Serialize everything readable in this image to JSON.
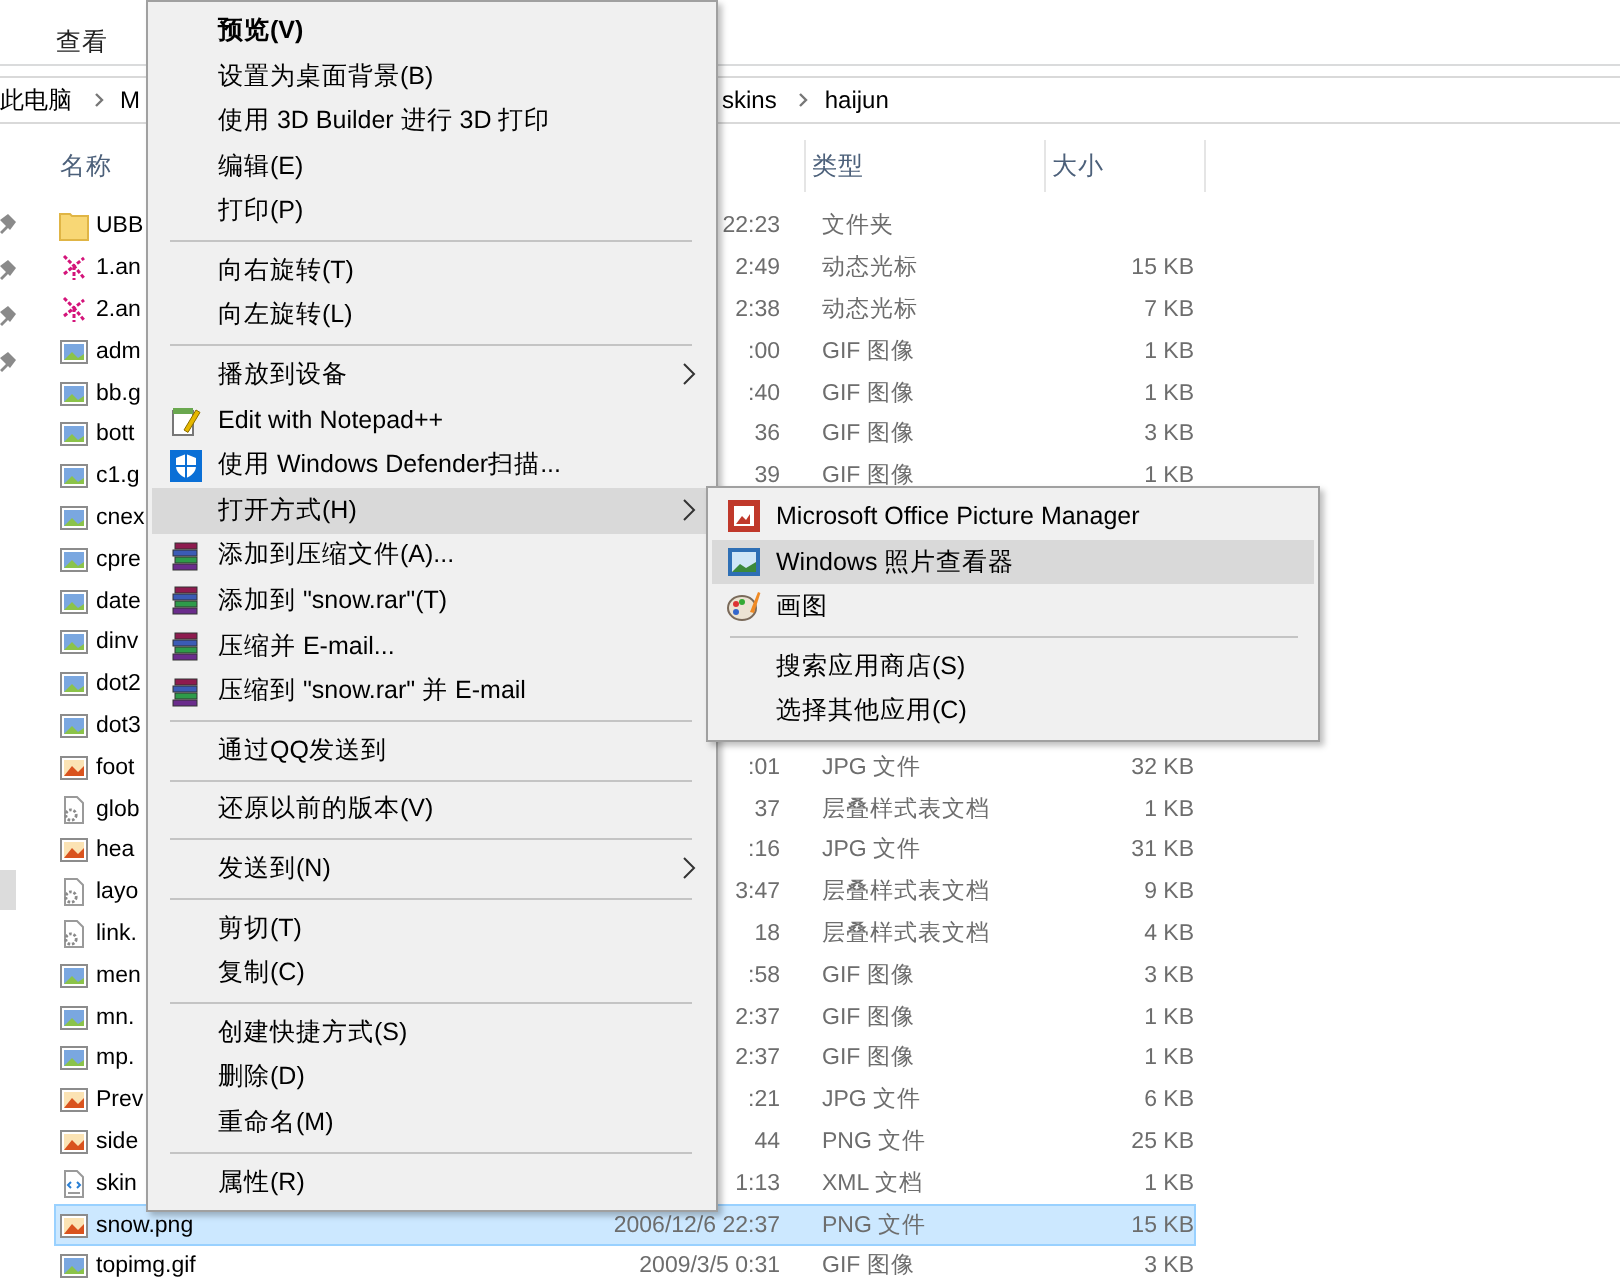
{
  "ribbon": {
    "tabs": [
      {
        "label": "查看"
      }
    ]
  },
  "address": {
    "left": [
      "此电脑",
      "M"
    ],
    "right": [
      "skins",
      "haijun"
    ]
  },
  "columns": [
    "名称",
    "类型",
    "大小"
  ],
  "files": [
    {
      "name": "UBB",
      "date": "22:23",
      "type": "文件夹",
      "kind": "folder",
      "selected": false
    },
    {
      "name": "1.an",
      "date": "2:49",
      "type": "动态光标",
      "size": "15 KB",
      "kind": "cursor",
      "selected": false
    },
    {
      "name": "2.an",
      "date": "2:38",
      "type": "动态光标",
      "size": "7 KB",
      "kind": "cursor",
      "selected": false
    },
    {
      "name": "adm",
      "date": ":00",
      "type": "GIF 图像",
      "size": "1 KB",
      "kind": "gif",
      "selected": false
    },
    {
      "name": "bb.g",
      "date": ":40",
      "type": "GIF 图像",
      "size": "1 KB",
      "kind": "gif",
      "selected": false
    },
    {
      "name": "bott",
      "date": "36",
      "type": "GIF 图像",
      "size": "3 KB",
      "kind": "gif",
      "selected": false
    },
    {
      "name": "c1.g",
      "date": "39",
      "type": "GIF 图像",
      "size": "1 KB",
      "kind": "gif",
      "selected": false
    },
    {
      "name": "cnex",
      "kind": "gif",
      "selected": false
    },
    {
      "name": "cpre",
      "kind": "gif",
      "selected": false
    },
    {
      "name": "date",
      "kind": "gif",
      "selected": false
    },
    {
      "name": "dinv",
      "kind": "gif",
      "selected": false
    },
    {
      "name": "dot2",
      "kind": "gif",
      "selected": false
    },
    {
      "name": "dot3",
      "kind": "gif",
      "selected": false
    },
    {
      "name": "foot",
      "date": ":01",
      "type": "JPG 文件",
      "size": "32 KB",
      "kind": "photo",
      "selected": false
    },
    {
      "name": "glob",
      "date": "37",
      "type": "层叠样式表文档",
      "size": "1 KB",
      "kind": "css",
      "selected": false
    },
    {
      "name": "hea",
      "date": ":16",
      "type": "JPG 文件",
      "size": "31 KB",
      "kind": "photo",
      "selected": false
    },
    {
      "name": "layo",
      "date": "3:47",
      "type": "层叠样式表文档",
      "size": "9 KB",
      "kind": "css",
      "selected": false
    },
    {
      "name": "link.",
      "date": "18",
      "type": "层叠样式表文档",
      "size": "4 KB",
      "kind": "css",
      "selected": false
    },
    {
      "name": "men",
      "date": ":58",
      "type": "GIF 图像",
      "size": "3 KB",
      "kind": "gif",
      "selected": false
    },
    {
      "name": "mn.",
      "date": "2:37",
      "type": "GIF 图像",
      "size": "1 KB",
      "kind": "gif",
      "selected": false
    },
    {
      "name": "mp.",
      "date": "2:37",
      "type": "GIF 图像",
      "size": "1 KB",
      "kind": "gif",
      "selected": false
    },
    {
      "name": "Prev",
      "date": ":21",
      "type": "JPG 文件",
      "size": "6 KB",
      "kind": "photo",
      "selected": false
    },
    {
      "name": "side",
      "date": "44",
      "type": "PNG 文件",
      "size": "25 KB",
      "kind": "photo",
      "selected": false
    },
    {
      "name": "skin",
      "date": "1:13",
      "type": "XML 文档",
      "size": "1 KB",
      "kind": "xml",
      "selected": false
    },
    {
      "name": "snow.png",
      "date": "2006/12/6 22:37",
      "type": "PNG 文件",
      "size": "15 KB",
      "kind": "photo",
      "selected": true
    },
    {
      "name": "topimg.gif",
      "date": "2009/3/5 0:31",
      "type": "GIF 图像",
      "size": "3 KB",
      "kind": "gif",
      "selected": false
    }
  ],
  "context_menu": {
    "items": [
      {
        "label": "预览(V)",
        "kind": "plain",
        "default": true,
        "submenu": false,
        "selected": false
      },
      {
        "label": "设置为桌面背景(B)",
        "kind": "plain",
        "default": false,
        "submenu": false,
        "selected": false
      },
      {
        "label": "使用 3D Builder 进行 3D 打印",
        "kind": "plain",
        "default": false,
        "submenu": false,
        "selected": false
      },
      {
        "label": "编辑(E)",
        "kind": "plain",
        "default": false,
        "submenu": false,
        "selected": false
      },
      {
        "label": "打印(P)",
        "kind": "plain",
        "default": false,
        "submenu": false,
        "selected": false
      },
      {
        "kind": "separator"
      },
      {
        "label": "向右旋转(T)",
        "kind": "plain",
        "default": false,
        "submenu": false,
        "selected": false
      },
      {
        "label": "向左旋转(L)",
        "kind": "plain",
        "default": false,
        "submenu": false,
        "selected": false
      },
      {
        "kind": "separator"
      },
      {
        "label": "播放到设备",
        "kind": "plain",
        "default": false,
        "submenu": true,
        "selected": false
      },
      {
        "label": "Edit with Notepad++",
        "kind": "notepad",
        "default": false,
        "submenu": false,
        "selected": false
      },
      {
        "label": "使用 Windows Defender扫描...",
        "kind": "defender",
        "default": false,
        "submenu": false,
        "selected": false
      },
      {
        "label": "打开方式(H)",
        "kind": "plain",
        "default": false,
        "submenu": true,
        "selected": true
      },
      {
        "label": "添加到压缩文件(A)...",
        "kind": "archive",
        "default": false,
        "submenu": false,
        "selected": false
      },
      {
        "label": "添加到 \"snow.rar\"(T)",
        "kind": "archive",
        "default": false,
        "submenu": false,
        "selected": false
      },
      {
        "label": "压缩并 E-mail...",
        "kind": "archive",
        "default": false,
        "submenu": false,
        "selected": false
      },
      {
        "label": "压缩到 \"snow.rar\" 并 E-mail",
        "kind": "archive",
        "default": false,
        "submenu": false,
        "selected": false
      },
      {
        "kind": "separator"
      },
      {
        "label": "通过QQ发送到",
        "kind": "plain",
        "default": false,
        "submenu": false,
        "selected": false
      },
      {
        "kind": "separator"
      },
      {
        "label": "还原以前的版本(V)",
        "kind": "plain",
        "default": false,
        "submenu": false,
        "selected": false
      },
      {
        "kind": "separator"
      },
      {
        "label": "发送到(N)",
        "kind": "plain",
        "default": false,
        "submenu": true,
        "selected": false
      },
      {
        "kind": "separator"
      },
      {
        "label": "剪切(T)",
        "kind": "plain",
        "default": false,
        "submenu": false,
        "selected": false
      },
      {
        "label": "复制(C)",
        "kind": "plain",
        "default": false,
        "submenu": false,
        "selected": false
      },
      {
        "kind": "separator"
      },
      {
        "label": "创建快捷方式(S)",
        "kind": "plain",
        "default": false,
        "submenu": false,
        "selected": false
      },
      {
        "label": "删除(D)",
        "kind": "plain",
        "default": false,
        "submenu": false,
        "selected": false
      },
      {
        "label": "重命名(M)",
        "kind": "plain",
        "default": false,
        "submenu": false,
        "selected": false
      },
      {
        "kind": "separator"
      },
      {
        "label": "属性(R)",
        "kind": "plain",
        "default": false,
        "submenu": false,
        "selected": false
      }
    ]
  },
  "submenu": {
    "items": [
      {
        "label": "Microsoft Office Picture Manager",
        "kind": "office",
        "selected": false
      },
      {
        "label": "Windows 照片查看器",
        "kind": "viewer",
        "selected": true
      },
      {
        "label": "画图",
        "kind": "paint",
        "selected": false
      },
      {
        "kind": "separator"
      },
      {
        "label": "搜索应用商店(S)",
        "kind": "plain",
        "selected": false
      },
      {
        "label": "选择其他应用(C)",
        "kind": "plain",
        "selected": false
      }
    ]
  }
}
